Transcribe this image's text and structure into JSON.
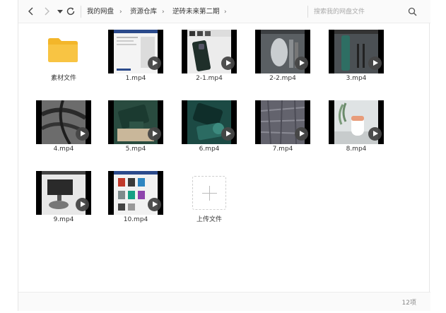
{
  "toolbar": {
    "breadcrumb": [
      "我的网盘",
      "资源仓库",
      "逆砖未来第二期"
    ],
    "search_placeholder": "搜索我的网盘文件"
  },
  "items": [
    {
      "label": "素材文件",
      "kind": "folder",
      "icons": [
        "folder-icon"
      ]
    },
    {
      "label": "1.mp4",
      "kind": "video",
      "icons": [
        "play-icon"
      ]
    },
    {
      "label": "2-1.mp4",
      "kind": "video",
      "icons": [
        "play-icon"
      ]
    },
    {
      "label": "2-2.mp4",
      "kind": "video",
      "icons": [
        "play-icon"
      ]
    },
    {
      "label": "3.mp4",
      "kind": "video",
      "icons": [
        "play-icon"
      ]
    },
    {
      "label": "4.mp4",
      "kind": "video",
      "icons": [
        "play-icon"
      ]
    },
    {
      "label": "5.mp4",
      "kind": "video",
      "icons": [
        "play-icon"
      ]
    },
    {
      "label": "6.mp4",
      "kind": "video",
      "icons": [
        "play-icon"
      ]
    },
    {
      "label": "7.mp4",
      "kind": "video",
      "icons": [
        "play-icon"
      ]
    },
    {
      "label": "8.mp4",
      "kind": "video",
      "icons": [
        "play-icon"
      ]
    },
    {
      "label": "9.mp4",
      "kind": "video",
      "icons": [
        "play-icon"
      ]
    },
    {
      "label": "10.mp4",
      "kind": "video",
      "icons": [
        "play-icon"
      ]
    },
    {
      "label": "上传文件",
      "kind": "upload",
      "icons": [
        "plus-icon"
      ]
    }
  ],
  "status": {
    "count": "12项"
  },
  "colors": {
    "folder": "#f8c443",
    "accent": "#333333"
  }
}
